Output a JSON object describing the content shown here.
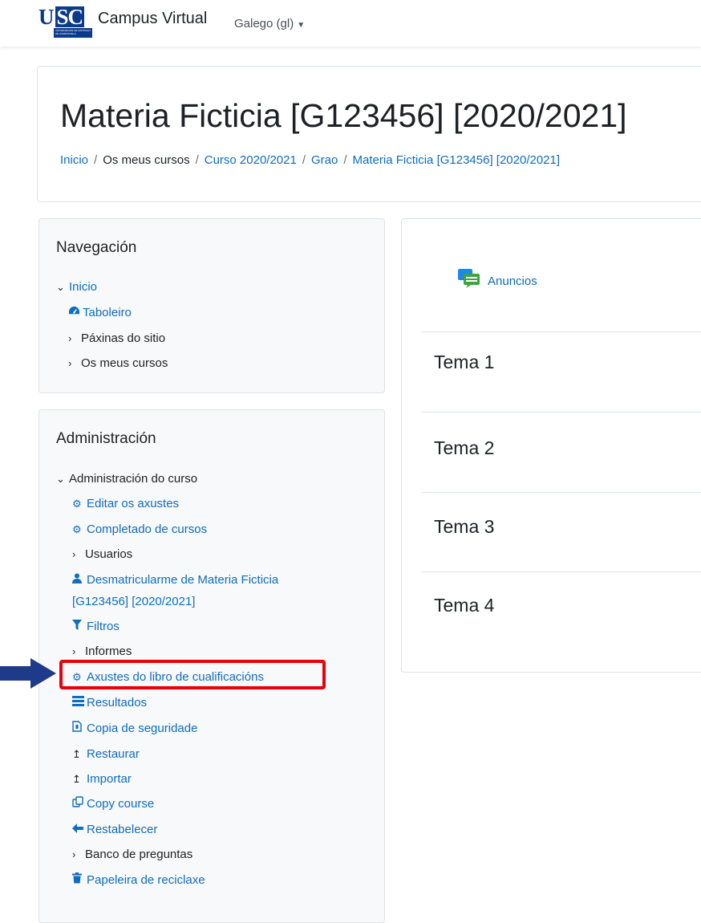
{
  "navbar": {
    "logo_text": "USC",
    "logo_subtext": "UNIVERSIDADE DE SANTIAGO DE COMPOSTELA",
    "brand": "Campus Virtual",
    "language": "Galego (gl)"
  },
  "header": {
    "title": "Materia Ficticia [G123456] [2020/2021]",
    "breadcrumb": [
      {
        "label": "Inicio"
      },
      {
        "label": "Os meus cursos"
      },
      {
        "label": "Curso 2020/2021"
      },
      {
        "label": "Grao"
      },
      {
        "label": "Materia Ficticia [G123456] [2020/2021]"
      }
    ]
  },
  "navigation": {
    "title": "Navegación",
    "items": [
      {
        "label": "Inicio",
        "icon": "chevron-down-icon"
      },
      {
        "label": "Taboleiro",
        "icon": "dashboard-icon"
      },
      {
        "label": "Páxinas do sitio",
        "icon": "chevron-right-icon"
      },
      {
        "label": "Os meus cursos",
        "icon": "chevron-right-icon"
      }
    ]
  },
  "administration": {
    "title": "Administración",
    "items": [
      {
        "label": "Administración do curso",
        "icon": "chevron-down-icon"
      },
      {
        "label": "Editar os axustes",
        "icon": "gear-icon"
      },
      {
        "label": "Completado de cursos",
        "icon": "gear-icon"
      },
      {
        "label": "Usuarios",
        "icon": "chevron-right-icon"
      },
      {
        "label": "Desmatricularme de Materia Ficticia",
        "label_line2": "[G123456] [2020/2021]",
        "icon": "user-icon"
      },
      {
        "label": "Filtros",
        "icon": "filter-icon"
      },
      {
        "label": "Informes",
        "icon": "chevron-right-icon"
      },
      {
        "label": "Axustes do libro de cualificacións",
        "icon": "gear-icon"
      },
      {
        "label": "Resultados",
        "icon": "results-icon"
      },
      {
        "label": "Copia de seguridade",
        "icon": "backup-file-icon"
      },
      {
        "label": "Restaurar",
        "icon": "upload-arrow-icon"
      },
      {
        "label": "Importar",
        "icon": "upload-arrow-icon"
      },
      {
        "label": "Copy course",
        "icon": "copy-icon"
      },
      {
        "label": "Restabelecer",
        "icon": "arrow-left-icon"
      },
      {
        "label": "Banco de preguntas",
        "icon": "chevron-right-icon"
      },
      {
        "label": "Papeleira de reciclaxe",
        "icon": "trash-icon"
      }
    ]
  },
  "main": {
    "forum_label": "Anuncios",
    "topics": [
      "Tema 1",
      "Tema 2",
      "Tema 3",
      "Tema 4"
    ]
  },
  "colors": {
    "link": "#0f6cbf",
    "highlight": "#e8000b",
    "arrow": "#1f3a8a",
    "logo": "#0b3a8c"
  }
}
